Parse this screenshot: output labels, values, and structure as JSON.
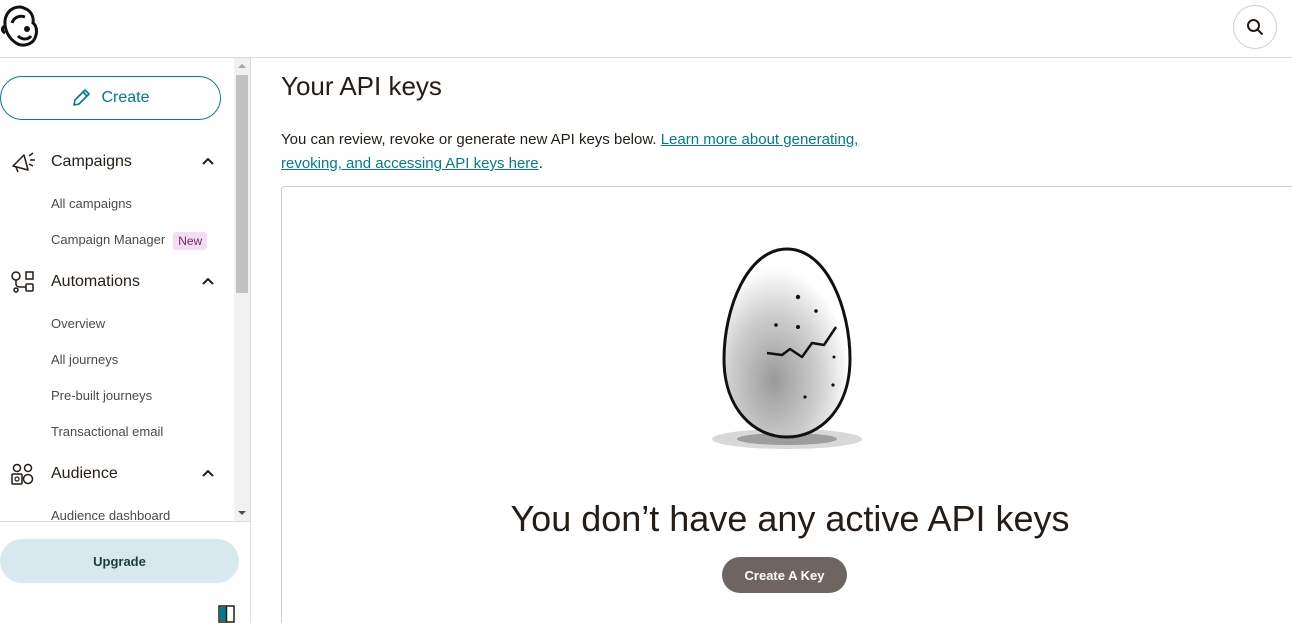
{
  "app": {
    "logo_icon": "mailchimp-freddie-logo",
    "search_icon": "search-icon"
  },
  "sidebar": {
    "create_label": "Create",
    "sections": [
      {
        "label": "Campaigns",
        "icon": "megaphone-icon",
        "items": [
          {
            "label": "All campaigns"
          },
          {
            "label": "Campaign Manager",
            "badge": "New"
          }
        ]
      },
      {
        "label": "Automations",
        "icon": "automation-flow-icon",
        "items": [
          {
            "label": "Overview"
          },
          {
            "label": "All journeys"
          },
          {
            "label": "Pre-built journeys"
          },
          {
            "label": "Transactional email"
          }
        ]
      },
      {
        "label": "Audience",
        "icon": "audience-icon",
        "items": [
          {
            "label": "Audience dashboard"
          }
        ]
      }
    ],
    "upgrade_label": "Upgrade"
  },
  "main": {
    "title": "Your API keys",
    "description_text": "You can review, revoke or generate new API keys below. ",
    "description_link": "Learn more about generating, revoking, and accessing API keys here",
    "description_end": ".",
    "empty_state": {
      "illustration": "cracked-egg-illustration",
      "title": "You don’t have any active API keys",
      "button_label": "Create A Key"
    }
  },
  "colors": {
    "accent": "#007c89",
    "button_dark": "#6e6562",
    "upgrade_bg": "#d7e9ee",
    "badge_bg": "#f7dcf7"
  }
}
